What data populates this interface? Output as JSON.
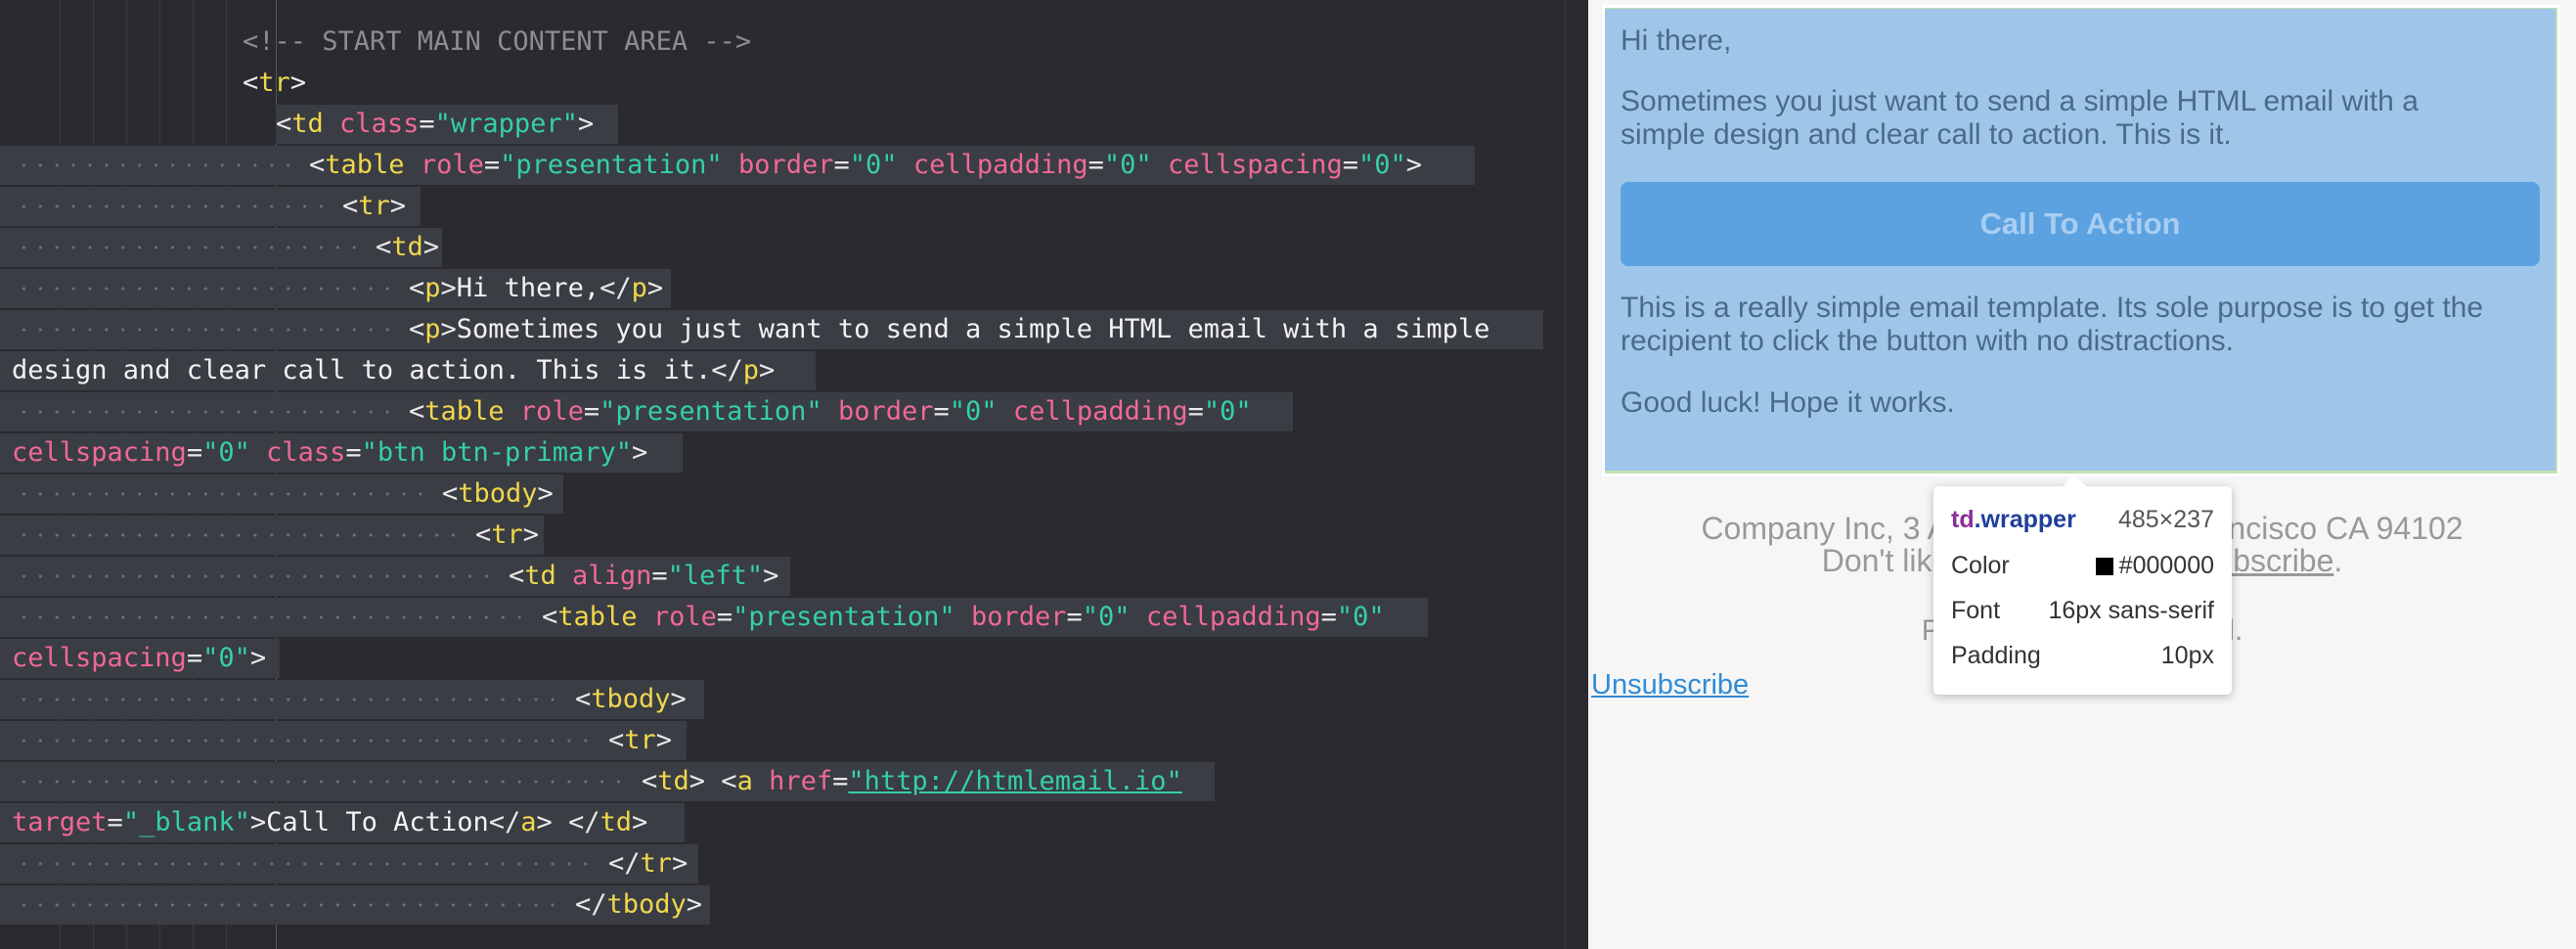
{
  "editor": {
    "lines": [
      [
        [
          "t-c",
          "<!-- START MAIN CONTENT AREA -->"
        ]
      ],
      [
        [
          "t-p",
          "<"
        ],
        [
          "t-tag",
          "tr"
        ],
        [
          "t-p",
          ">"
        ]
      ],
      [
        [
          "t-p",
          "<"
        ],
        [
          "t-tag",
          "td"
        ],
        [
          "t-p",
          " "
        ],
        [
          "t-attr",
          "class"
        ],
        [
          "t-p",
          "="
        ],
        [
          "t-str",
          "\"wrapper\""
        ],
        [
          "t-p",
          ">"
        ]
      ],
      [
        [
          "t-p",
          "<"
        ],
        [
          "t-tag",
          "table"
        ],
        [
          "t-p",
          " "
        ],
        [
          "t-attr",
          "role"
        ],
        [
          "t-p",
          "="
        ],
        [
          "t-str",
          "\"presentation\""
        ],
        [
          "t-p",
          " "
        ],
        [
          "t-attr",
          "border"
        ],
        [
          "t-p",
          "="
        ],
        [
          "t-str",
          "\"0\""
        ],
        [
          "t-p",
          " "
        ],
        [
          "t-attr",
          "cellpadding"
        ],
        [
          "t-p",
          "="
        ],
        [
          "t-str",
          "\"0\""
        ],
        [
          "t-p",
          " "
        ],
        [
          "t-attr",
          "cellspacing"
        ],
        [
          "t-p",
          "="
        ],
        [
          "t-str",
          "\"0\""
        ],
        [
          "t-p",
          ">"
        ]
      ],
      [
        [
          "t-p",
          "<"
        ],
        [
          "t-tag",
          "tr"
        ],
        [
          "t-p",
          ">"
        ]
      ],
      [
        [
          "t-p",
          "<"
        ],
        [
          "t-tag",
          "td"
        ],
        [
          "t-p",
          ">"
        ]
      ],
      [
        [
          "t-p",
          "<"
        ],
        [
          "t-tag",
          "p"
        ],
        [
          "t-p",
          ">"
        ],
        [
          "t-txt",
          "Hi there,"
        ],
        [
          "t-p",
          "</"
        ],
        [
          "t-tag",
          "p"
        ],
        [
          "t-p",
          ">"
        ]
      ],
      [
        [
          "t-p",
          "<"
        ],
        [
          "t-tag",
          "p"
        ],
        [
          "t-p",
          ">"
        ],
        [
          "t-txt",
          "Sometimes you just want to send a simple HTML email with a simple"
        ]
      ],
      [
        [
          "t-txt",
          "design and clear call to action. This is it."
        ],
        [
          "t-p",
          "</"
        ],
        [
          "t-tag",
          "p"
        ],
        [
          "t-p",
          ">"
        ]
      ],
      [
        [
          "t-p",
          "<"
        ],
        [
          "t-tag",
          "table"
        ],
        [
          "t-p",
          " "
        ],
        [
          "t-attr",
          "role"
        ],
        [
          "t-p",
          "="
        ],
        [
          "t-str",
          "\"presentation\""
        ],
        [
          "t-p",
          " "
        ],
        [
          "t-attr",
          "border"
        ],
        [
          "t-p",
          "="
        ],
        [
          "t-str",
          "\"0\""
        ],
        [
          "t-p",
          " "
        ],
        [
          "t-attr",
          "cellpadding"
        ],
        [
          "t-p",
          "="
        ],
        [
          "t-str",
          "\"0\""
        ]
      ],
      [
        [
          "t-attr",
          "cellspacing"
        ],
        [
          "t-p",
          "="
        ],
        [
          "t-str",
          "\"0\""
        ],
        [
          "t-p",
          " "
        ],
        [
          "t-attr",
          "class"
        ],
        [
          "t-p",
          "="
        ],
        [
          "t-str",
          "\"btn btn-primary\""
        ],
        [
          "t-p",
          ">"
        ]
      ],
      [
        [
          "t-p",
          "<"
        ],
        [
          "t-tag",
          "tbody"
        ],
        [
          "t-p",
          ">"
        ]
      ],
      [
        [
          "t-p",
          "<"
        ],
        [
          "t-tag",
          "tr"
        ],
        [
          "t-p",
          ">"
        ]
      ],
      [
        [
          "t-p",
          "<"
        ],
        [
          "t-tag",
          "td"
        ],
        [
          "t-p",
          " "
        ],
        [
          "t-attr",
          "align"
        ],
        [
          "t-p",
          "="
        ],
        [
          "t-str",
          "\"left\""
        ],
        [
          "t-p",
          ">"
        ]
      ],
      [
        [
          "t-p",
          "<"
        ],
        [
          "t-tag",
          "table"
        ],
        [
          "t-p",
          " "
        ],
        [
          "t-attr",
          "role"
        ],
        [
          "t-p",
          "="
        ],
        [
          "t-str",
          "\"presentation\""
        ],
        [
          "t-p",
          " "
        ],
        [
          "t-attr",
          "border"
        ],
        [
          "t-p",
          "="
        ],
        [
          "t-str",
          "\"0\""
        ],
        [
          "t-p",
          " "
        ],
        [
          "t-attr",
          "cellpadding"
        ],
        [
          "t-p",
          "="
        ],
        [
          "t-str",
          "\"0\""
        ]
      ],
      [
        [
          "t-attr",
          "cellspacing"
        ],
        [
          "t-p",
          "="
        ],
        [
          "t-str",
          "\"0\""
        ],
        [
          "t-p",
          ">"
        ]
      ],
      [
        [
          "t-p",
          "<"
        ],
        [
          "t-tag",
          "tbody"
        ],
        [
          "t-p",
          ">"
        ]
      ],
      [
        [
          "t-p",
          "<"
        ],
        [
          "t-tag",
          "tr"
        ],
        [
          "t-p",
          ">"
        ]
      ],
      [
        [
          "t-p",
          "<"
        ],
        [
          "t-tag",
          "td"
        ],
        [
          "t-p",
          "> <"
        ],
        [
          "t-tag",
          "a"
        ],
        [
          "t-p",
          " "
        ],
        [
          "t-attr",
          "href"
        ],
        [
          "t-p",
          "="
        ],
        [
          "t-url",
          "\"http://htmlemail.io\""
        ]
      ],
      [
        [
          "t-attr",
          "target"
        ],
        [
          "t-p",
          "="
        ],
        [
          "t-str",
          "\"_blank\""
        ],
        [
          "t-p",
          ">"
        ],
        [
          "t-txt",
          "Call To Action"
        ],
        [
          "t-p",
          "</"
        ],
        [
          "t-tag",
          "a"
        ],
        [
          "t-p",
          "> </"
        ],
        [
          "t-tag",
          "td"
        ],
        [
          "t-p",
          ">"
        ]
      ],
      [
        [
          "t-p",
          "</"
        ],
        [
          "t-tag",
          "tr"
        ],
        [
          "t-p",
          ">"
        ]
      ],
      [
        [
          "t-p",
          "</"
        ],
        [
          "t-tag",
          "tbody"
        ],
        [
          "t-p",
          ">"
        ]
      ]
    ]
  },
  "preview": {
    "greeting": "Hi there,",
    "body1": "Sometimes you just want to send a simple HTML email with a simple design and clear call to action. This is it.",
    "cta_label": "Call To Action",
    "body2": "This is a really simple email template. Its sole purpose is to get the recipient to click the button with no distractions.",
    "body3": "Good luck! Hope it works.",
    "footer_address": "Company Inc, 3 Abbey Road, San Francisco CA 94102",
    "footer_unsub_prefix": "Don't like these emails? ",
    "footer_unsub_link": "Unsubscribe",
    "footer_unsub_suffix": ".",
    "footer_powered": "Powered by HTMLemail.",
    "unsubscribe_link": "Unsubscribe"
  },
  "tooltip": {
    "selector_tag": "td",
    "selector_class": ".wrapper",
    "dimensions": "485×237",
    "color_label": "Color",
    "color_value": "#000000",
    "font_label": "Font",
    "font_value": "16px sans-serif",
    "padding_label": "Padding",
    "padding_value": "10px",
    "swatch_color": "#000000"
  }
}
